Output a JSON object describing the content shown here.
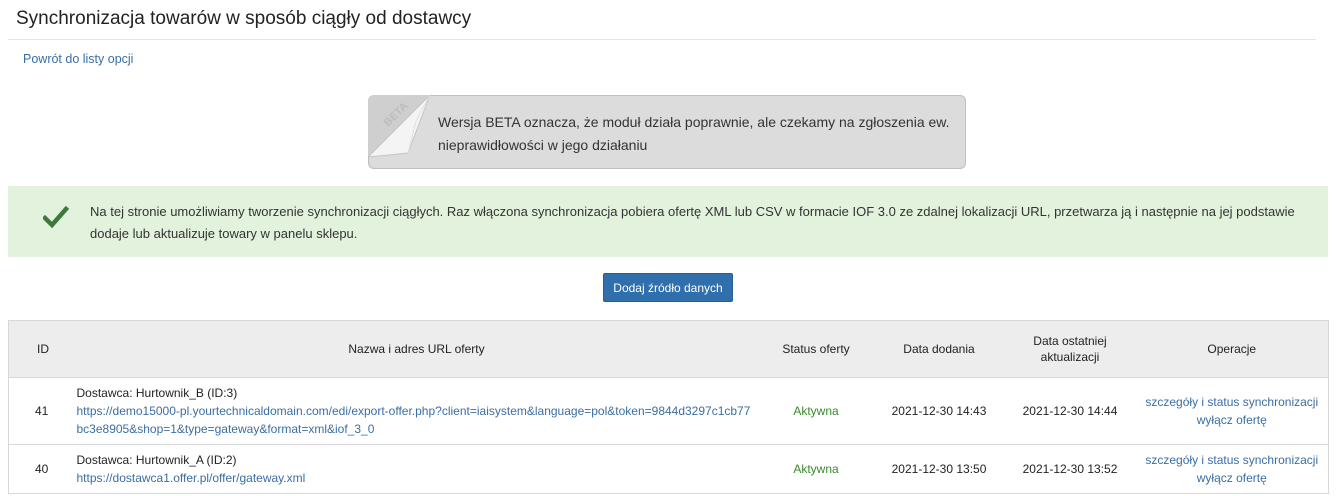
{
  "page": {
    "title": "Synchronizacja towarów w sposób ciągły od dostawcy",
    "back_link": "Powrót do listy opcji"
  },
  "beta": {
    "ribbon": "BETA",
    "text": "Wersja BETA oznacza, że moduł działa poprawnie, ale czekamy na zgłoszenia ew. nieprawidłowości w jego działaniu"
  },
  "info": {
    "text": "Na tej stronie umożliwiamy tworzenie synchronizacji ciągłych. Raz włączona synchronizacja pobiera ofertę XML lub CSV w formacie IOF 3.0 ze zdalnej lokalizacji URL, przetwarza ją i następnie na jej podstawie dodaje lub aktualizuje towary w panelu sklepu.",
    "icon": "check-icon",
    "icon_color": "#3c7a3c"
  },
  "actions": {
    "add_source_label": "Dodaj źródło danych"
  },
  "table": {
    "headers": {
      "id": "ID",
      "name": "Nazwa i adres URL oferty",
      "status": "Status oferty",
      "date_added": "Data dodania",
      "date_updated": "Data ostatniej aktualizacji",
      "operations": "Operacje"
    },
    "rows": [
      {
        "id": "41",
        "supplier": "Dostawca: Hurtownik_B (ID:3)",
        "url": "https://demo15000-pl.yourtechnicaldomain.com/edi/export-offer.php?client=iaisystem&language=pol&token=9844d3297c1cb77bc3e8905&shop=1&type=gateway&format=xml&iof_3_0",
        "status": "Aktywna",
        "date_added": "2021-12-30 14:43",
        "date_updated": "2021-12-30 14:44",
        "op_details": "szczegóły i status synchronizacji",
        "op_disable": "wyłącz ofertę"
      },
      {
        "id": "40",
        "supplier": "Dostawca: Hurtownik_A (ID:2)",
        "url": "https://dostawca1.offer.pl/offer/gateway.xml",
        "status": "Aktywna",
        "date_added": "2021-12-30 13:50",
        "date_updated": "2021-12-30 13:52",
        "op_details": "szczegóły i status synchronizacji",
        "op_disable": "wyłącz ofertę"
      }
    ]
  },
  "colors": {
    "link": "#3a6ea5",
    "button": "#2f6fab",
    "status_active": "#3c8a2e",
    "info_background": "#e3f2dc",
    "beta_background": "#dcdcdc"
  }
}
